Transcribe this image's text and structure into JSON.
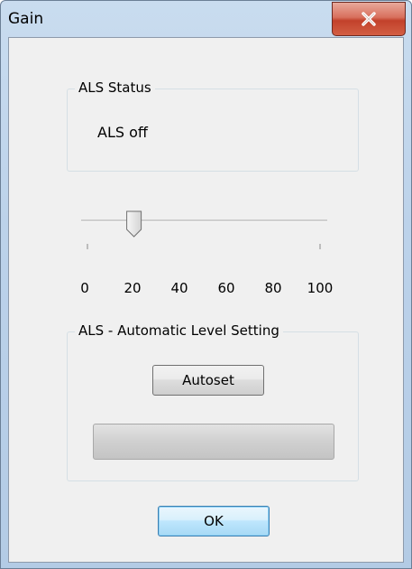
{
  "window": {
    "title": "Gain",
    "close_icon": "close-x-icon"
  },
  "als_status": {
    "legend": "ALS Status",
    "text": "ALS off"
  },
  "slider": {
    "min": 0,
    "max": 100,
    "value": 20,
    "tick_labels": [
      "0",
      "20",
      "40",
      "60",
      "80",
      "100"
    ]
  },
  "als_setting": {
    "legend": "ALS -  Automatic Level Setting",
    "autoset_label": "Autoset",
    "progress": 0
  },
  "ok_label": "OK",
  "colors": {
    "close_button": "#c94a35",
    "dialog_background": "#f0f0f0",
    "ok_button_border": "#3c7fb1"
  }
}
